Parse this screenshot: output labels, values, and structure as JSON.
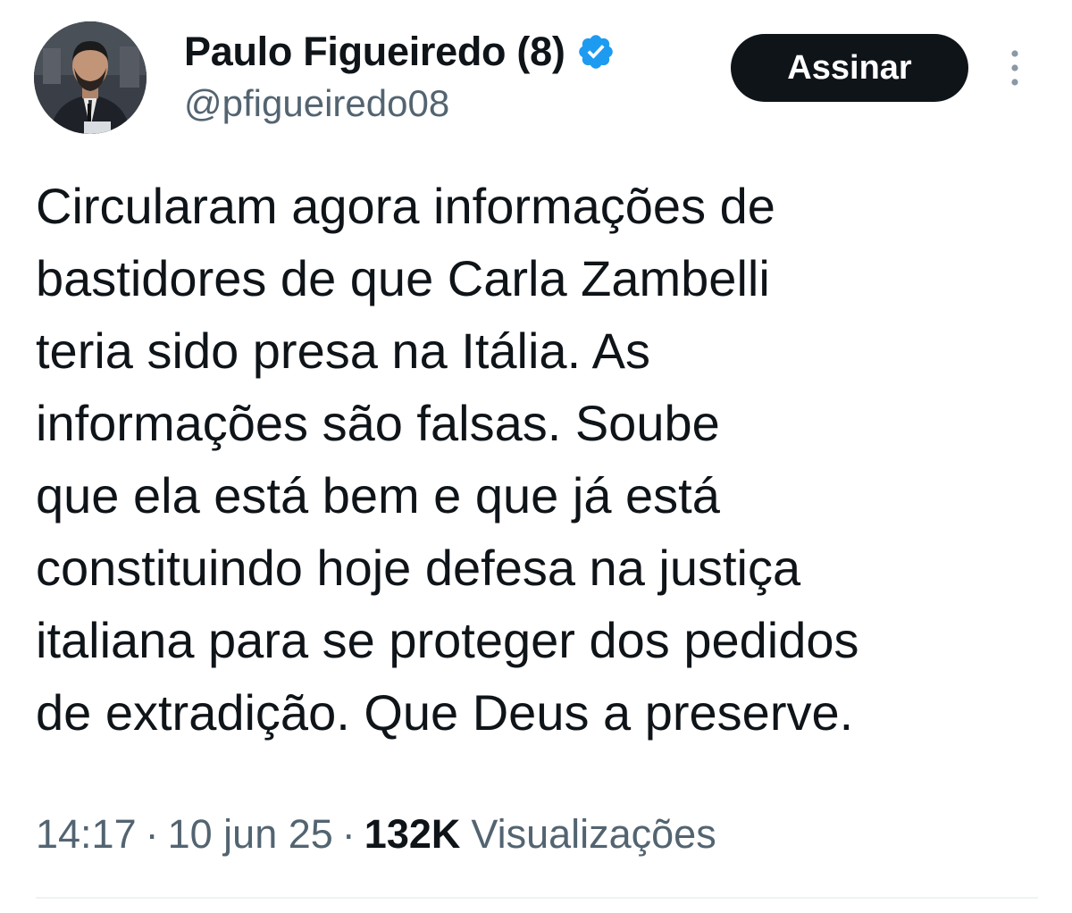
{
  "author": {
    "display_name": "Paulo Figueiredo (8)",
    "handle": "@pfigueiredo08",
    "verified": true,
    "avatar_icon": "profile-photo"
  },
  "actions": {
    "subscribe_label": "Assinar",
    "more_icon": "more-vertical-icon"
  },
  "tweet": {
    "lines": [
      "Circularam agora informações de",
      "bastidores de que Carla Zambelli",
      "teria sido presa na Itália. As",
      "informações são falsas. Soube",
      "que ela está bem e que já está",
      "constituindo hoje defesa na justiça",
      "italiana para se proteger dos pedidos",
      "de extradição. Que Deus a preserve."
    ]
  },
  "meta": {
    "time": "14:17",
    "separator": "·",
    "date": "10 jun 25",
    "views_count": "132K",
    "views_label": "Visualizações"
  },
  "colors": {
    "text_primary": "#0f1419",
    "text_secondary": "#536471",
    "verified_blue": "#1d9bf0",
    "button_bg": "#0f1419",
    "divider": "#eff3f4"
  }
}
